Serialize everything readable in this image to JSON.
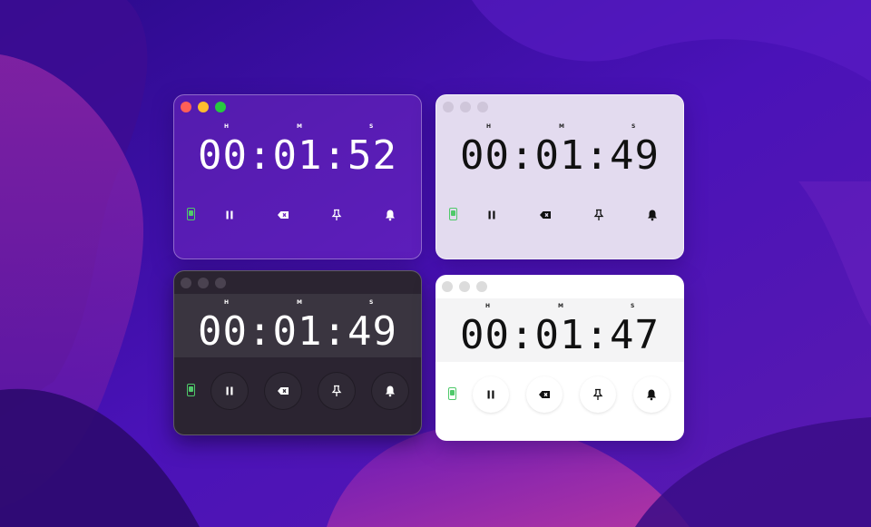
{
  "windows": [
    {
      "theme": "purple-translucent",
      "units": {
        "h": "H",
        "m": "M",
        "s": "S"
      },
      "time": "00:01:52",
      "controls": [
        "battery-icon",
        "pause-icon",
        "clear-icon",
        "pin-icon",
        "bell-icon"
      ]
    },
    {
      "theme": "lilac",
      "units": {
        "h": "H",
        "m": "M",
        "s": "S"
      },
      "time": "00:01:49",
      "controls": [
        "battery-icon",
        "pause-icon",
        "clear-icon",
        "pin-icon",
        "bell-icon"
      ]
    },
    {
      "theme": "dark",
      "units": {
        "h": "H",
        "m": "M",
        "s": "S"
      },
      "time": "00:01:49",
      "controls": [
        "battery-icon",
        "pause-icon",
        "clear-icon",
        "pin-icon",
        "bell-icon"
      ]
    },
    {
      "theme": "white",
      "units": {
        "h": "H",
        "m": "M",
        "s": "S"
      },
      "time": "00:01:47",
      "controls": [
        "battery-icon",
        "pause-icon",
        "clear-icon",
        "pin-icon",
        "bell-icon"
      ]
    }
  ],
  "colors": {
    "wallpaper": "#3a0f9e",
    "battery_accent": "#4fc96a",
    "traffic_close": "#ff5f57",
    "traffic_min": "#febc2e",
    "traffic_max": "#28c840"
  }
}
